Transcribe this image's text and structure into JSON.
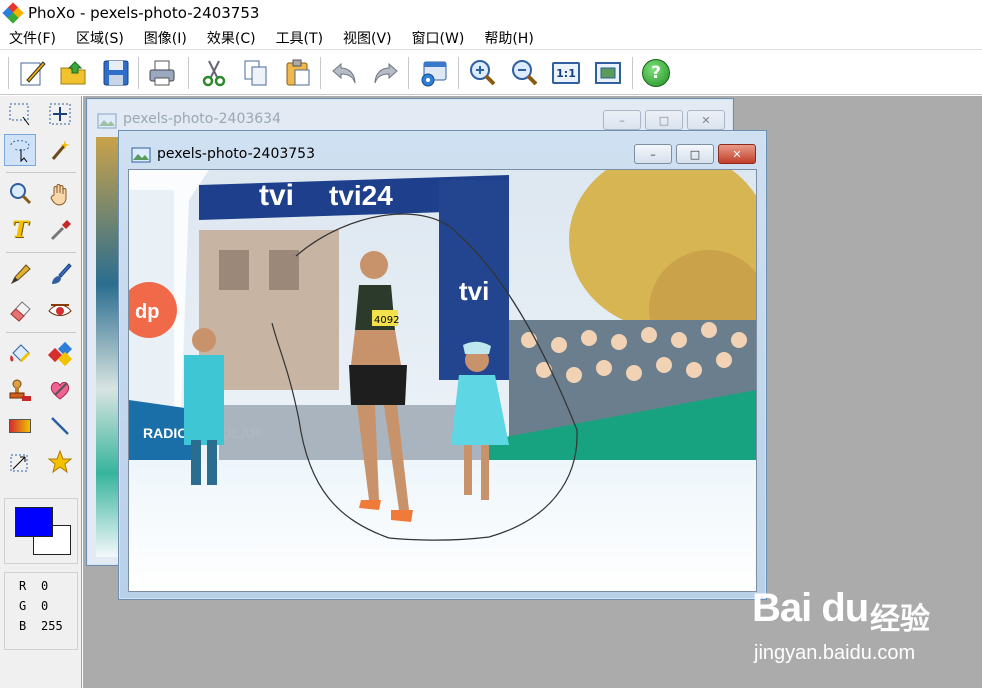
{
  "app": {
    "title": "PhoXo - pexels-photo-2403753"
  },
  "menu": [
    {
      "label": "文件(F)"
    },
    {
      "label": "区域(S)"
    },
    {
      "label": "图像(I)"
    },
    {
      "label": "效果(C)"
    },
    {
      "label": "工具(T)"
    },
    {
      "label": "视图(V)"
    },
    {
      "label": "窗口(W)"
    },
    {
      "label": "帮助(H)"
    }
  ],
  "toolbar": {
    "icons": [
      "new-icon",
      "open-icon",
      "save-icon",
      "print-icon",
      "cut-icon",
      "copy-icon",
      "paste-icon",
      "undo-icon",
      "redo-icon",
      "screen-capture-icon",
      "zoom-in-icon",
      "zoom-out-icon",
      "actual-size-icon",
      "fit-window-icon",
      "help-icon"
    ],
    "actual_size_label": "1:1",
    "help_label": "?"
  },
  "toolbox": {
    "tools": [
      "rect-select-icon",
      "move-icon",
      "lasso-icon",
      "magic-wand-icon",
      "zoom-icon",
      "hand-icon",
      "text-icon",
      "eyedropper-icon",
      "pen-icon",
      "brush-icon",
      "eraser-icon",
      "red-eye-icon",
      "fill-icon",
      "color-replace-icon",
      "stamp-icon",
      "heal-icon",
      "gradient-icon",
      "line-icon",
      "transform-icon",
      "star-icon"
    ],
    "text_tool_label": "T",
    "foreground_color": "#0000ff",
    "background_color": "#ffffff"
  },
  "rgb": {
    "r_label": "R",
    "r": "0",
    "g_label": "G",
    "g": "0",
    "b_label": "B",
    "b": "255"
  },
  "windows": {
    "back": {
      "title": "pexels-photo-2403634"
    },
    "front": {
      "title": "pexels-photo-2403753"
    }
  },
  "photo": {
    "banner_text": "tvi",
    "banner_text2": "tvi24",
    "bib_number": "4092",
    "logo_text": "dp",
    "sign_text": "RADIO POPULAR"
  },
  "window_controls": {
    "minimize": "–",
    "restore": "□",
    "close": "✕"
  },
  "watermark": {
    "logo": "Bai du",
    "cn": "经验",
    "url": "jingyan.baidu.com"
  }
}
